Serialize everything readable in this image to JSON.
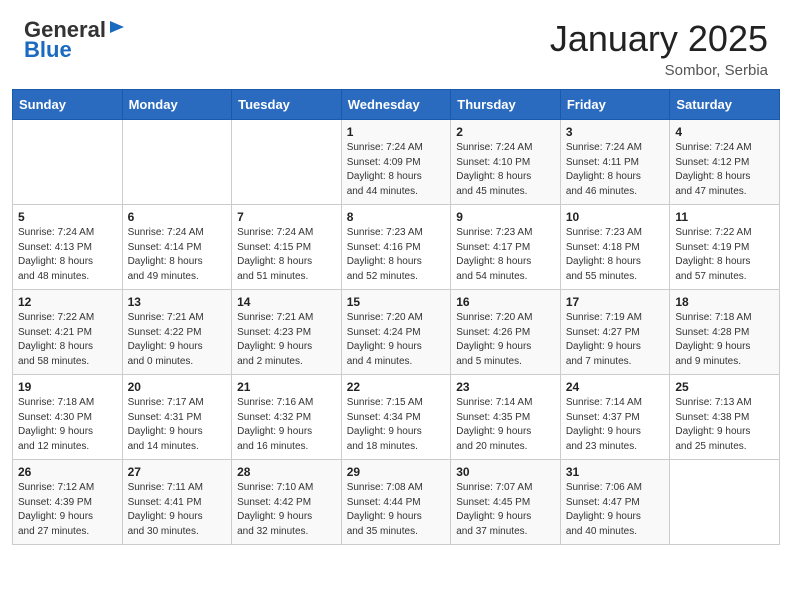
{
  "logo": {
    "general": "General",
    "blue": "Blue"
  },
  "header": {
    "title": "January 2025",
    "subtitle": "Sombor, Serbia"
  },
  "weekdays": [
    "Sunday",
    "Monday",
    "Tuesday",
    "Wednesday",
    "Thursday",
    "Friday",
    "Saturday"
  ],
  "weeks": [
    [
      {
        "day": "",
        "info": ""
      },
      {
        "day": "",
        "info": ""
      },
      {
        "day": "",
        "info": ""
      },
      {
        "day": "1",
        "info": "Sunrise: 7:24 AM\nSunset: 4:09 PM\nDaylight: 8 hours\nand 44 minutes."
      },
      {
        "day": "2",
        "info": "Sunrise: 7:24 AM\nSunset: 4:10 PM\nDaylight: 8 hours\nand 45 minutes."
      },
      {
        "day": "3",
        "info": "Sunrise: 7:24 AM\nSunset: 4:11 PM\nDaylight: 8 hours\nand 46 minutes."
      },
      {
        "day": "4",
        "info": "Sunrise: 7:24 AM\nSunset: 4:12 PM\nDaylight: 8 hours\nand 47 minutes."
      }
    ],
    [
      {
        "day": "5",
        "info": "Sunrise: 7:24 AM\nSunset: 4:13 PM\nDaylight: 8 hours\nand 48 minutes."
      },
      {
        "day": "6",
        "info": "Sunrise: 7:24 AM\nSunset: 4:14 PM\nDaylight: 8 hours\nand 49 minutes."
      },
      {
        "day": "7",
        "info": "Sunrise: 7:24 AM\nSunset: 4:15 PM\nDaylight: 8 hours\nand 51 minutes."
      },
      {
        "day": "8",
        "info": "Sunrise: 7:23 AM\nSunset: 4:16 PM\nDaylight: 8 hours\nand 52 minutes."
      },
      {
        "day": "9",
        "info": "Sunrise: 7:23 AM\nSunset: 4:17 PM\nDaylight: 8 hours\nand 54 minutes."
      },
      {
        "day": "10",
        "info": "Sunrise: 7:23 AM\nSunset: 4:18 PM\nDaylight: 8 hours\nand 55 minutes."
      },
      {
        "day": "11",
        "info": "Sunrise: 7:22 AM\nSunset: 4:19 PM\nDaylight: 8 hours\nand 57 minutes."
      }
    ],
    [
      {
        "day": "12",
        "info": "Sunrise: 7:22 AM\nSunset: 4:21 PM\nDaylight: 8 hours\nand 58 minutes."
      },
      {
        "day": "13",
        "info": "Sunrise: 7:21 AM\nSunset: 4:22 PM\nDaylight: 9 hours\nand 0 minutes."
      },
      {
        "day": "14",
        "info": "Sunrise: 7:21 AM\nSunset: 4:23 PM\nDaylight: 9 hours\nand 2 minutes."
      },
      {
        "day": "15",
        "info": "Sunrise: 7:20 AM\nSunset: 4:24 PM\nDaylight: 9 hours\nand 4 minutes."
      },
      {
        "day": "16",
        "info": "Sunrise: 7:20 AM\nSunset: 4:26 PM\nDaylight: 9 hours\nand 5 minutes."
      },
      {
        "day": "17",
        "info": "Sunrise: 7:19 AM\nSunset: 4:27 PM\nDaylight: 9 hours\nand 7 minutes."
      },
      {
        "day": "18",
        "info": "Sunrise: 7:18 AM\nSunset: 4:28 PM\nDaylight: 9 hours\nand 9 minutes."
      }
    ],
    [
      {
        "day": "19",
        "info": "Sunrise: 7:18 AM\nSunset: 4:30 PM\nDaylight: 9 hours\nand 12 minutes."
      },
      {
        "day": "20",
        "info": "Sunrise: 7:17 AM\nSunset: 4:31 PM\nDaylight: 9 hours\nand 14 minutes."
      },
      {
        "day": "21",
        "info": "Sunrise: 7:16 AM\nSunset: 4:32 PM\nDaylight: 9 hours\nand 16 minutes."
      },
      {
        "day": "22",
        "info": "Sunrise: 7:15 AM\nSunset: 4:34 PM\nDaylight: 9 hours\nand 18 minutes."
      },
      {
        "day": "23",
        "info": "Sunrise: 7:14 AM\nSunset: 4:35 PM\nDaylight: 9 hours\nand 20 minutes."
      },
      {
        "day": "24",
        "info": "Sunrise: 7:14 AM\nSunset: 4:37 PM\nDaylight: 9 hours\nand 23 minutes."
      },
      {
        "day": "25",
        "info": "Sunrise: 7:13 AM\nSunset: 4:38 PM\nDaylight: 9 hours\nand 25 minutes."
      }
    ],
    [
      {
        "day": "26",
        "info": "Sunrise: 7:12 AM\nSunset: 4:39 PM\nDaylight: 9 hours\nand 27 minutes."
      },
      {
        "day": "27",
        "info": "Sunrise: 7:11 AM\nSunset: 4:41 PM\nDaylight: 9 hours\nand 30 minutes."
      },
      {
        "day": "28",
        "info": "Sunrise: 7:10 AM\nSunset: 4:42 PM\nDaylight: 9 hours\nand 32 minutes."
      },
      {
        "day": "29",
        "info": "Sunrise: 7:08 AM\nSunset: 4:44 PM\nDaylight: 9 hours\nand 35 minutes."
      },
      {
        "day": "30",
        "info": "Sunrise: 7:07 AM\nSunset: 4:45 PM\nDaylight: 9 hours\nand 37 minutes."
      },
      {
        "day": "31",
        "info": "Sunrise: 7:06 AM\nSunset: 4:47 PM\nDaylight: 9 hours\nand 40 minutes."
      },
      {
        "day": "",
        "info": ""
      }
    ]
  ]
}
